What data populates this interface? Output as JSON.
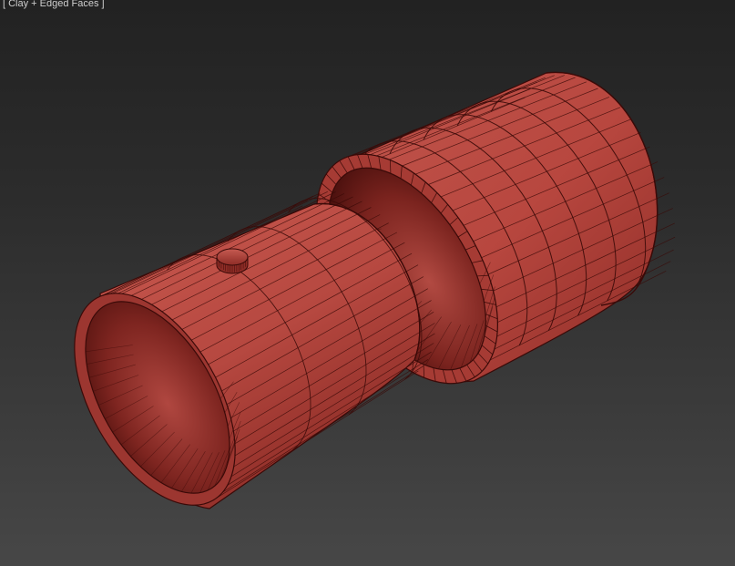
{
  "viewport": {
    "label": "[ Clay + Edged Faces ]",
    "shading_mode": "Clay + Edged Faces",
    "background_top": "#222222",
    "background_bottom": "#474747"
  },
  "model": {
    "parts": [
      "outer-sleeve",
      "inner-tube",
      "locking-pin"
    ],
    "colors": {
      "clay_base": "#b8473f",
      "clay_dark": "#5e1512",
      "clay_light": "#cc5f55",
      "wire": "#3a0a08"
    }
  }
}
